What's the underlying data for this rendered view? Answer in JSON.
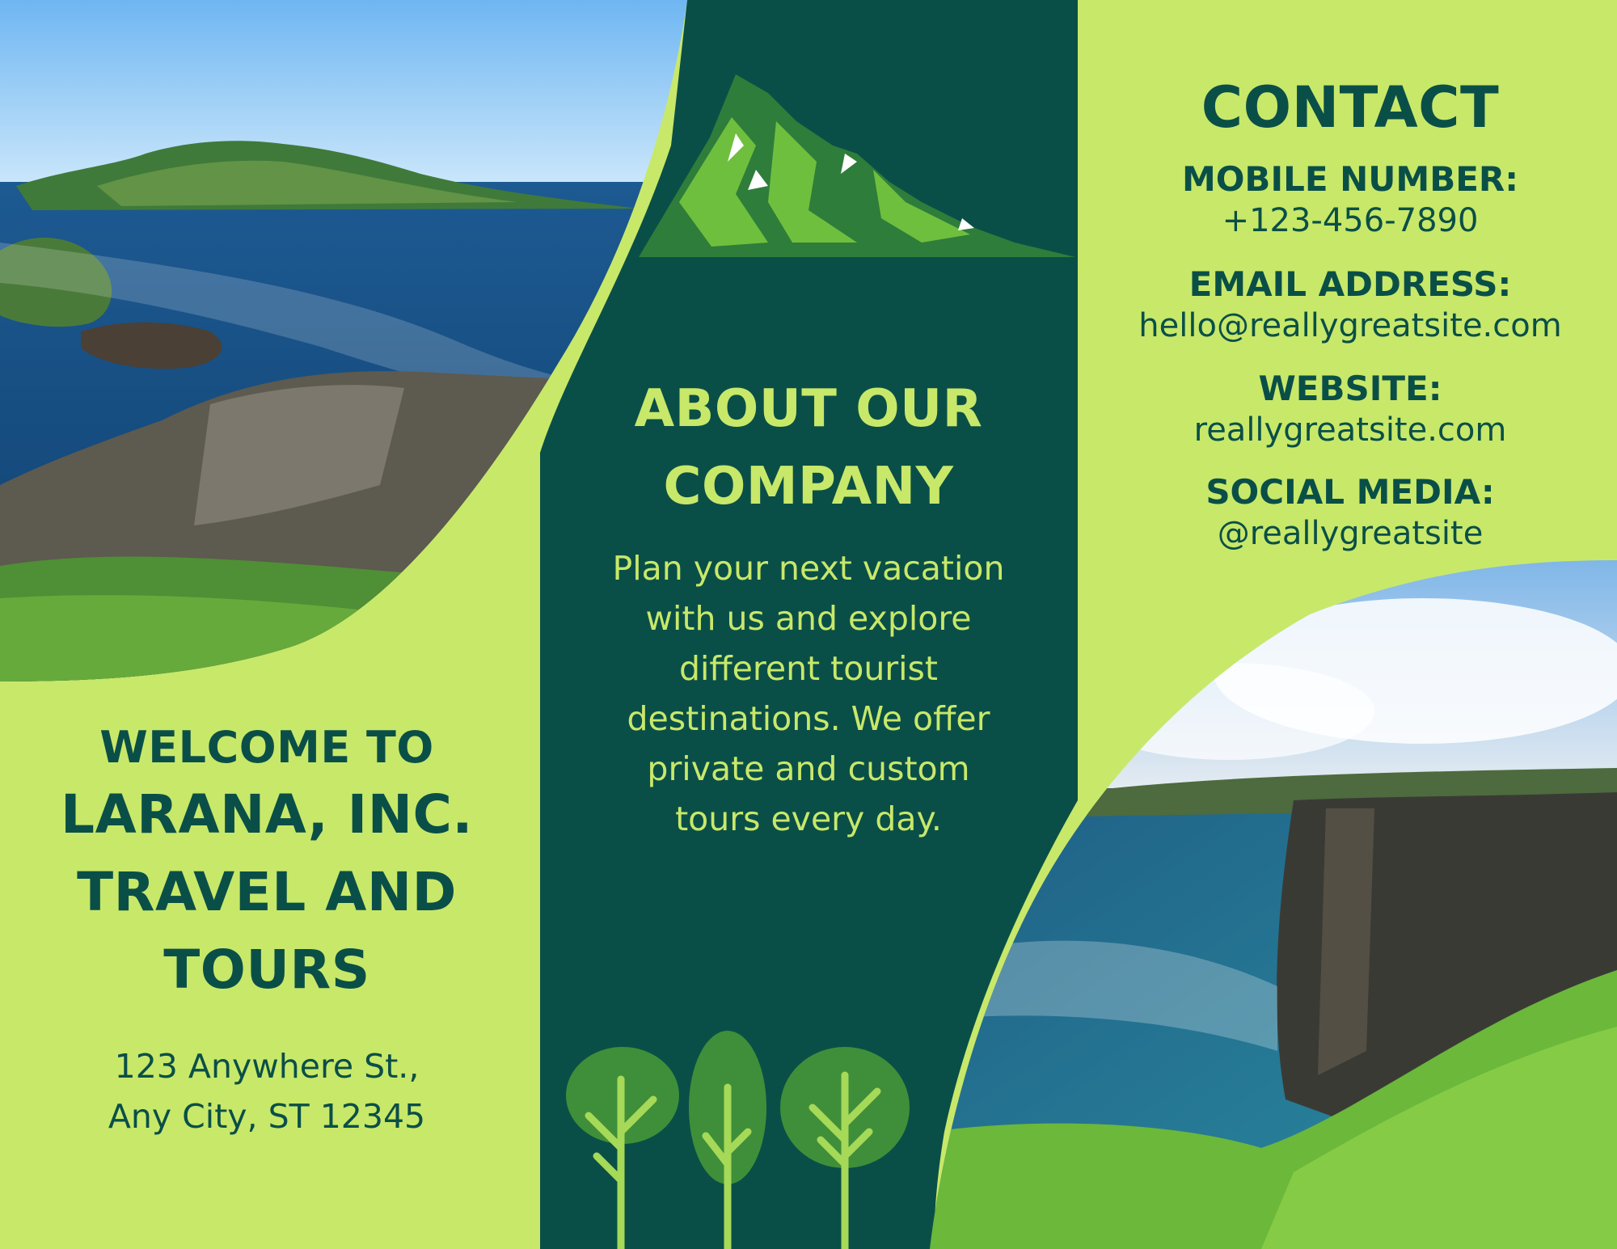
{
  "panels": {
    "left": {
      "welcome": "WELCOME TO",
      "company_line1": "LARANA, INC.",
      "company_line2": "TRAVEL AND",
      "company_line3": "TOURS",
      "address_line1": "123 Anywhere St.,",
      "address_line2": "Any City, ST 12345"
    },
    "middle": {
      "title_line1": "ABOUT OUR",
      "title_line2": "COMPANY",
      "body_lines": [
        "Plan your next vacation",
        "with us and explore",
        "different tourist",
        "destinations. We offer",
        "private and custom",
        "tours every day."
      ]
    },
    "right": {
      "title": "CONTACT",
      "items": [
        {
          "label": "MOBILE NUMBER:",
          "value": "+123-456-7890"
        },
        {
          "label": "EMAIL ADDRESS:",
          "value": "hello@reallygreatsite.com"
        },
        {
          "label": "WEBSITE:",
          "value": "reallygreatsite.com"
        },
        {
          "label": "SOCIAL MEDIA:",
          "value": "@reallygreatsite"
        }
      ]
    }
  },
  "colors": {
    "lime": "#c8e86a",
    "dark_teal": "#0a4f47",
    "mid_green": "#3f8f3a",
    "leaf_green": "#6fbf3e"
  },
  "illustrations": [
    "mountain-icon",
    "trees-icon",
    "coast-photo-top-left",
    "cliff-photo-bottom-right"
  ]
}
